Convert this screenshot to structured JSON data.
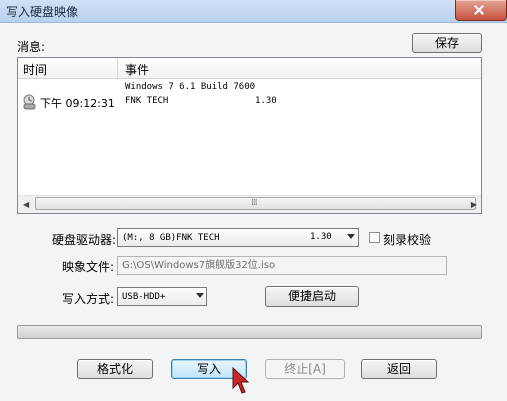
{
  "window": {
    "title": "写入硬盘映像"
  },
  "messages": {
    "label": "消息:",
    "save_button": "保存",
    "columns": [
      "时间",
      "事件"
    ],
    "rows": [
      {
        "time": "",
        "event": "Windows 7 6.1 Build 7600"
      },
      {
        "time": "下午 09:12:31",
        "event": "FNK TECH",
        "extra": "1.30"
      }
    ]
  },
  "form": {
    "drive_label": "硬盘驱动器:",
    "drive_value": "(M:, 8 GB)FNK TECH",
    "drive_version": "1.30",
    "verify_label": "刻录校验",
    "verify_checked": false,
    "image_label": "映象文件:",
    "image_value": "G:\\OS\\Windows7旗舰版32位.iso",
    "method_label": "写入方式:",
    "method_value": "USB-HDD+",
    "quick_boot_button": "便捷启动"
  },
  "progress": {
    "value": 0
  },
  "buttons": {
    "format": "格式化",
    "write": "写入",
    "stop": "终止[A]",
    "back": "返回"
  },
  "icons": {
    "close": "close-icon",
    "clock": "clock-user-icon",
    "cursor": "mouse-cursor-icon"
  }
}
